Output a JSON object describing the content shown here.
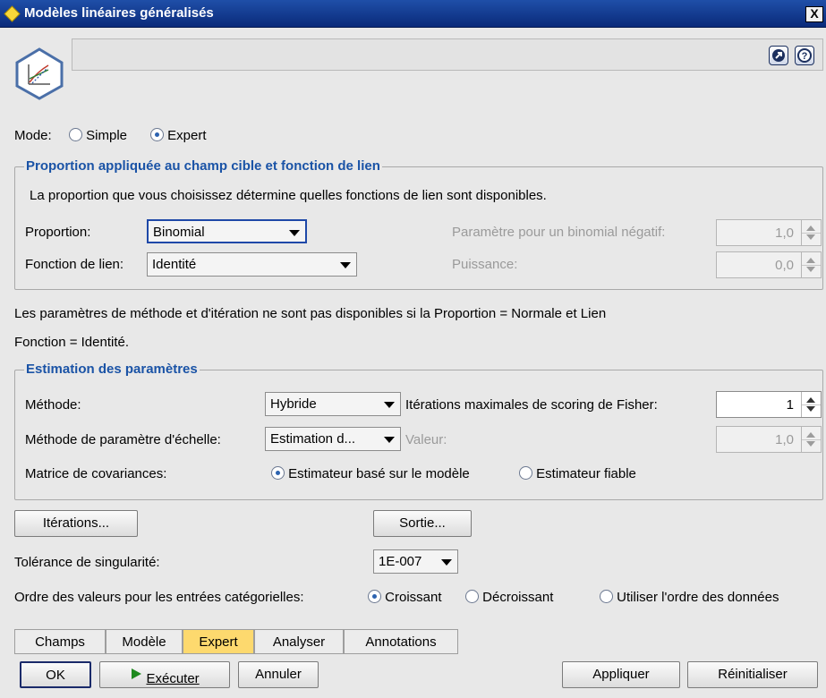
{
  "window": {
    "title": "Modèles linéaires généralisés",
    "close_label": "X"
  },
  "header": {
    "icons": [
      "generalized-linear-node-icon",
      "expand-icon",
      "help-icon"
    ]
  },
  "mode": {
    "label": "Mode:",
    "options": [
      {
        "label": "Simple",
        "selected": false
      },
      {
        "label": "Expert",
        "selected": true
      }
    ]
  },
  "group1": {
    "title": "Proportion appliquée au champ cible et fonction de lien",
    "description": "La proportion que vous choisissez détermine quelles fonctions de lien sont disponibles.",
    "proportion_label": "Proportion:",
    "proportion_value": "Binomial",
    "link_label": "Fonction de lien:",
    "link_value": "Identité",
    "neg_binomial_label": "Paramètre pour un binomial négatif:",
    "neg_binomial_value": "1,0",
    "power_label": "Puissance:",
    "power_value": "0,0"
  },
  "note": {
    "line1": "Les paramètres de méthode et d'itération ne sont pas disponibles si la Proportion = Normale et Lien",
    "line2": "Fonction = Identité."
  },
  "group2": {
    "title": "Estimation des paramètres",
    "method_label": "Méthode:",
    "method_value": "Hybride",
    "fisher_label": "Itérations maximales de scoring de Fisher:",
    "fisher_value": "1",
    "scale_label": "Méthode de paramètre d'échelle:",
    "scale_value": "Estimation d...",
    "value_label": "Valeur:",
    "value_value": "1,0",
    "cov_label": "Matrice de covariances:",
    "cov_options": [
      {
        "label": "Estimateur basé sur le modèle",
        "selected": true
      },
      {
        "label": "Estimateur fiable",
        "selected": false
      }
    ]
  },
  "buttons": {
    "iterations": "Itérations...",
    "output": "Sortie..."
  },
  "tolerance": {
    "label": "Tolérance de singularité:",
    "value": "1E-007"
  },
  "order": {
    "label": "Ordre des valeurs pour les entrées catégorielles:",
    "options": [
      {
        "label": "Croissant",
        "selected": true
      },
      {
        "label": "Décroissant",
        "selected": false
      },
      {
        "label": "Utiliser l'ordre des données",
        "selected": false
      }
    ]
  },
  "tabs": [
    {
      "label": "Champs",
      "active": false
    },
    {
      "label": "Modèle",
      "active": false
    },
    {
      "label": "Expert",
      "active": true
    },
    {
      "label": "Analyser",
      "active": false
    },
    {
      "label": "Annotations",
      "active": false
    }
  ],
  "footer": {
    "ok": "OK",
    "run": "Exécuter",
    "cancel": "Annuler",
    "apply": "Appliquer",
    "reset": "Réinitialiser"
  },
  "colors": {
    "title_bar": "#0a2a7a",
    "group_title": "#1a53a6",
    "active_tab": "#fdd96e",
    "run_arrow": "#1e8a1e"
  }
}
